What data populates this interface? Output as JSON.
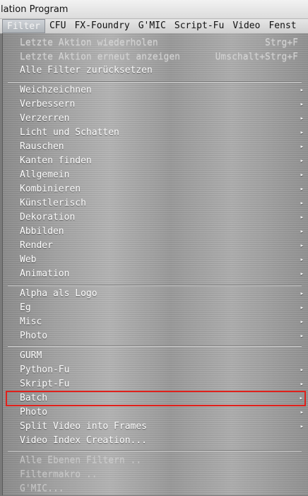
{
  "window": {
    "title": "lation Program"
  },
  "menubar": {
    "items": [
      "Filter",
      "CFU",
      "FX-Foundry",
      "G'MIC",
      "Script-Fu",
      "Video",
      "Fenst"
    ]
  },
  "menu": {
    "top_disabled": [
      {
        "label": "Letzte Aktion wiederholen",
        "accel": "Strg+F"
      },
      {
        "label": "Letzte Aktion erneut anzeigen",
        "accel": "Umschalt+Strg+F"
      }
    ],
    "reset": "Alle Filter zurücksetzen",
    "group1": [
      "Weichzeichnen",
      "Verbessern",
      "Verzerren",
      "Licht und Schatten",
      "Rauschen",
      "Kanten finden",
      "Allgemein",
      "Kombinieren",
      "Künstlerisch",
      "Dekoration",
      "Abbilden",
      "Render",
      "Web",
      "Animation"
    ],
    "group2": [
      "Alpha als Logo",
      "Eg",
      "Misc",
      "Photo"
    ],
    "group3": [
      {
        "label": "GURM",
        "submenu": false
      },
      {
        "label": "Python-Fu",
        "submenu": true
      },
      {
        "label": "Skript-Fu",
        "submenu": true
      },
      {
        "label": "Batch",
        "submenu": true
      },
      {
        "label": "Photo",
        "submenu": true
      },
      {
        "label": "Split Video into Frames",
        "submenu": true
      },
      {
        "label": "Video Index Creation...",
        "submenu": false
      }
    ],
    "bottom_disabled": [
      "Alle Ebenen Filtern ..",
      "Filtermakro ..",
      "G'MIC..."
    ],
    "arrow_glyph": "▸"
  }
}
